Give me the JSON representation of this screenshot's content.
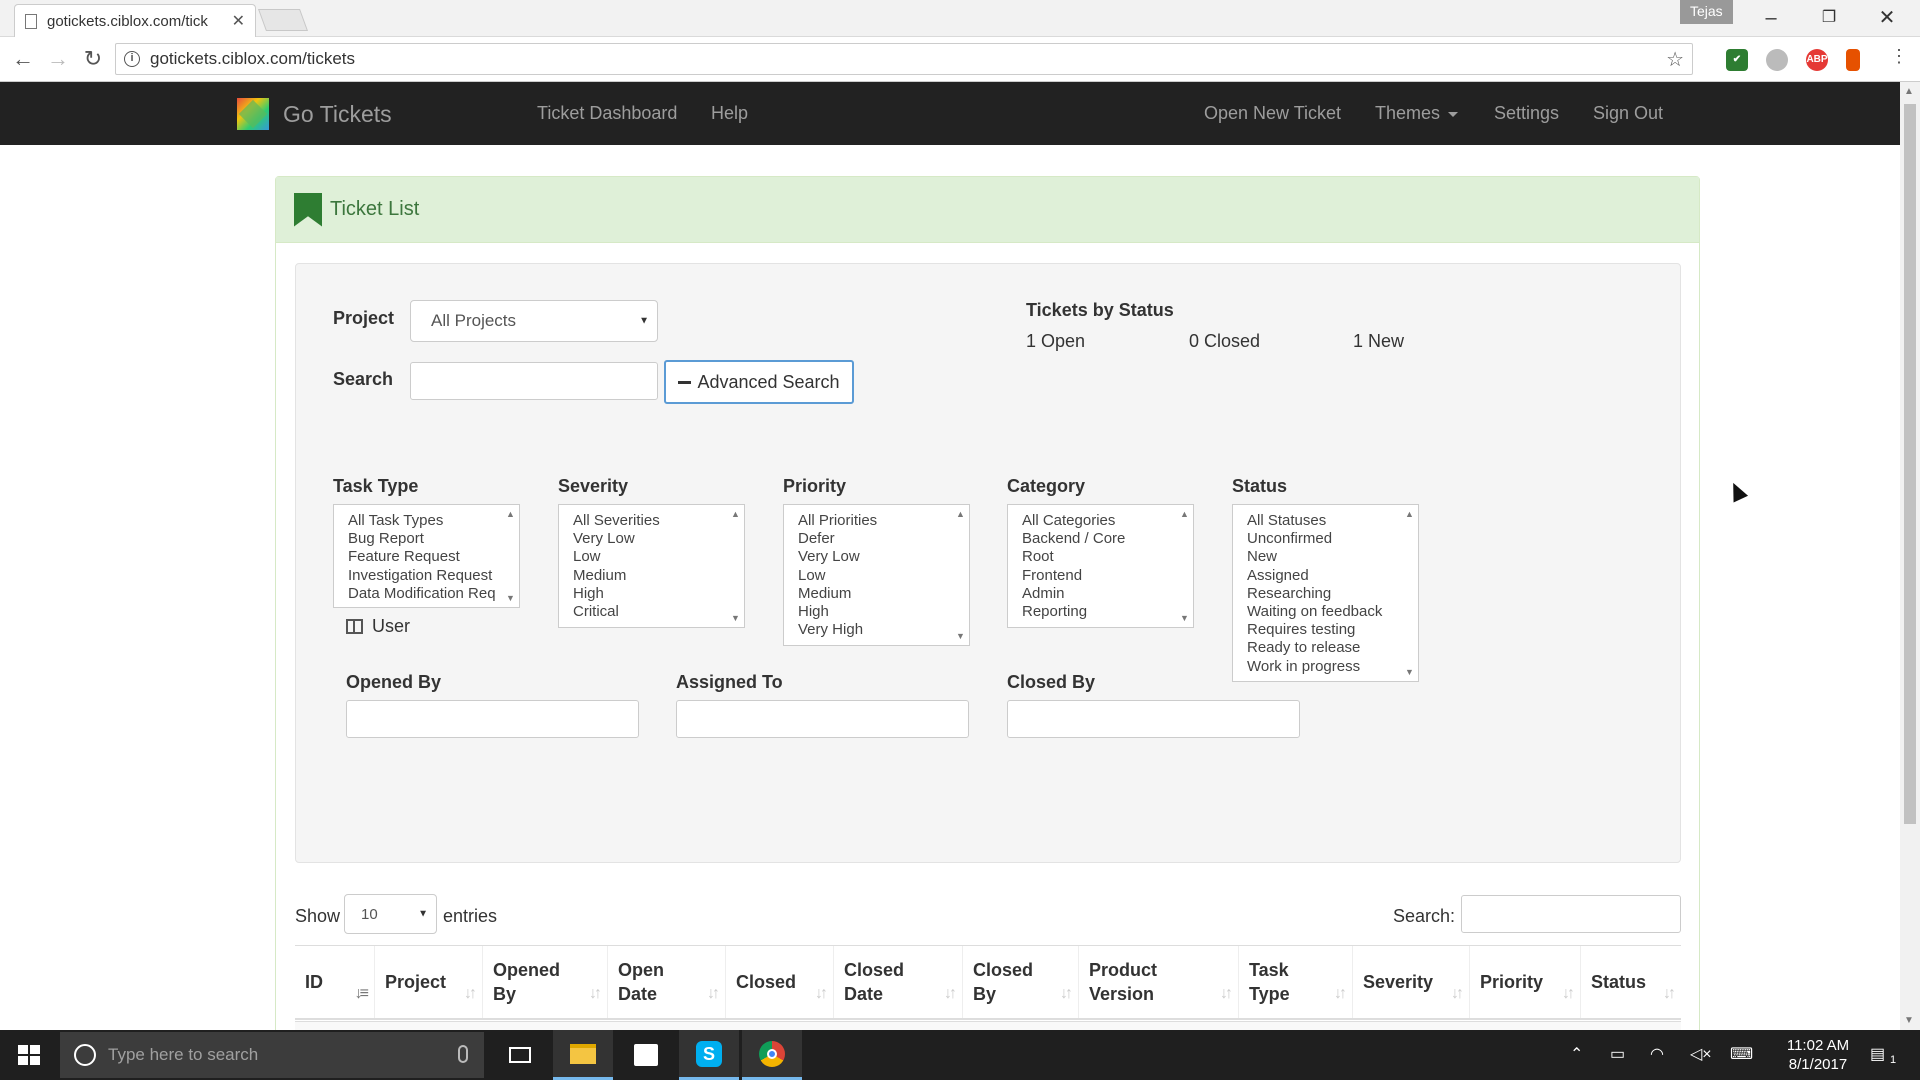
{
  "browser": {
    "tab_title": "gotickets.ciblox.com/tick",
    "user_badge": "Tejas",
    "url": "gotickets.ciblox.com/tickets",
    "extensions": [
      "ABP"
    ]
  },
  "navbar": {
    "brand": "Go Tickets",
    "links": [
      "Ticket Dashboard",
      "Help"
    ],
    "right_links": [
      "Open New Ticket",
      "Themes",
      "Settings",
      "Sign Out"
    ]
  },
  "panel": {
    "title": "Ticket List"
  },
  "filters": {
    "project_label": "Project",
    "project_value": "All Projects",
    "search_label": "Search",
    "advanced_search": "Advanced Search",
    "status_heading": "Tickets by Status",
    "status_counts": [
      "1 Open",
      "0 Closed",
      "1 New"
    ],
    "task_type": {
      "label": "Task Type",
      "options": [
        "All Task Types",
        "Bug Report",
        "Feature Request",
        "Investigation Request",
        "Data Modification Req"
      ]
    },
    "severity": {
      "label": "Severity",
      "options": [
        "All Severities",
        "Very Low",
        "Low",
        "Medium",
        "High",
        "Critical"
      ]
    },
    "priority": {
      "label": "Priority",
      "options": [
        "All Priorities",
        "Defer",
        "Very Low",
        "Low",
        "Medium",
        "High",
        "Very High"
      ]
    },
    "category": {
      "label": "Category",
      "options": [
        "All Categories",
        "Backend / Core",
        "Root",
        "Frontend",
        "Admin",
        "Reporting"
      ]
    },
    "status": {
      "label": "Status",
      "options": [
        "All Statuses",
        "Unconfirmed",
        "New",
        "Assigned",
        "Researching",
        "Waiting on feedback",
        "Requires testing",
        "Ready to release",
        "Work in progress"
      ]
    },
    "user_toggle": "User",
    "opened_by": "Opened By",
    "assigned_to": "Assigned To",
    "closed_by": "Closed By"
  },
  "table": {
    "show_label": "Show",
    "entries_value": "10",
    "entries_label": "entries",
    "search_label": "Search:",
    "columns": [
      {
        "line1": "ID",
        "line2": ""
      },
      {
        "line1": "Project",
        "line2": ""
      },
      {
        "line1": "Opened",
        "line2": "By"
      },
      {
        "line1": "Open",
        "line2": "Date"
      },
      {
        "line1": "Closed",
        "line2": ""
      },
      {
        "line1": "Closed",
        "line2": "Date"
      },
      {
        "line1": "Closed",
        "line2": "By"
      },
      {
        "line1": "Product",
        "line2": "Version"
      },
      {
        "line1": "Task",
        "line2": "Type"
      },
      {
        "line1": "Severity",
        "line2": ""
      },
      {
        "line1": "Priority",
        "line2": ""
      },
      {
        "line1": "Status",
        "line2": ""
      }
    ]
  },
  "taskbar": {
    "search_placeholder": "Type here to search",
    "time": "11:02 AM",
    "date": "8/1/2017",
    "notifications": "1"
  },
  "colors": {
    "navbar_bg": "#222222",
    "panel_heading_bg": "#dff0d8",
    "panel_heading_text": "#3c763d",
    "filter_bg": "#f5f5f5"
  }
}
